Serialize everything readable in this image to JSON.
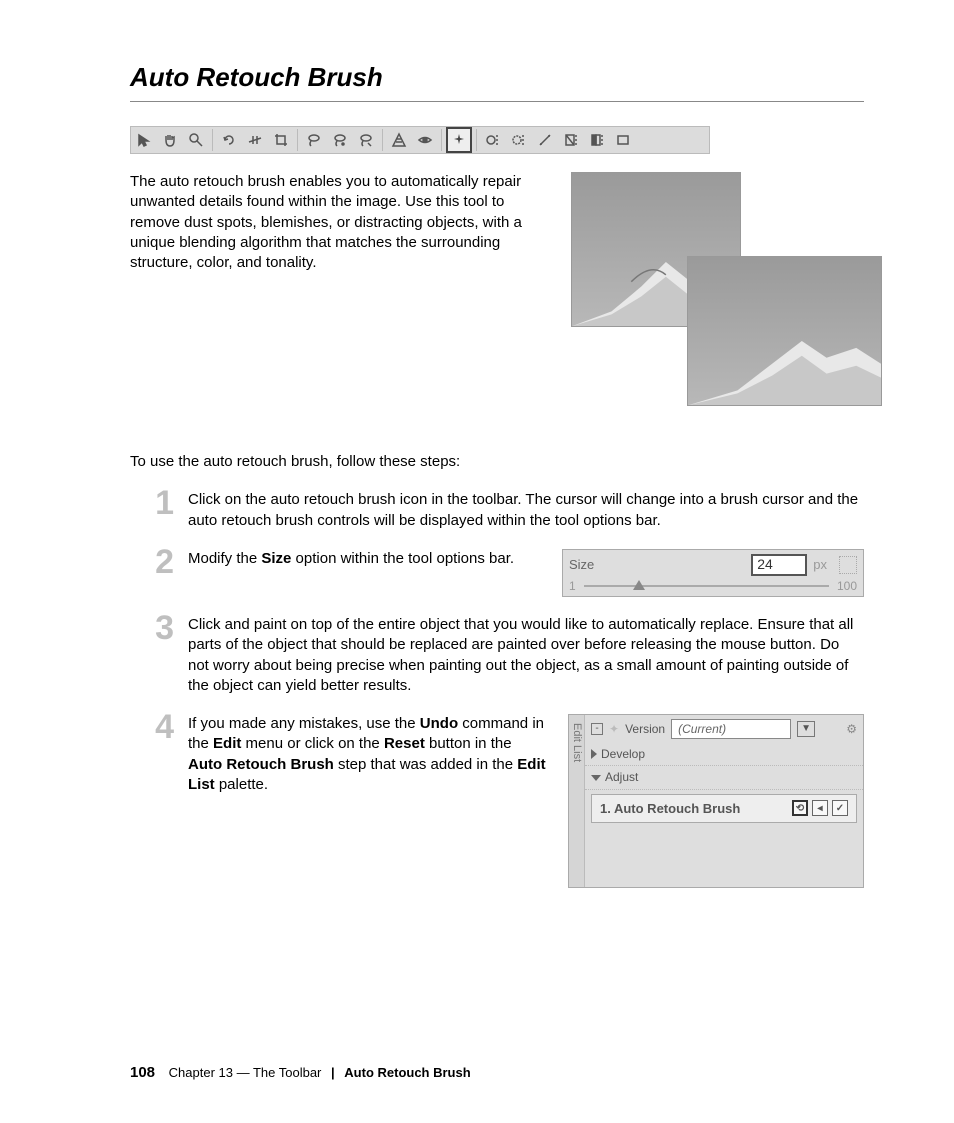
{
  "title": "Auto Retouch Brush",
  "intro": "The auto retouch brush enables you to automatically repair unwanted details found within the image. Use this tool to remove dust spots, blemishes, or distracting objects, with a unique blending algorithm that matches the surrounding structure, color, and tonality.",
  "followup": "To use the auto retouch brush, follow these steps:",
  "steps": {
    "s1": "Click on the auto retouch brush icon in the toolbar. The cursor will change into a brush cursor and the auto retouch brush controls will be displayed within the tool options bar.",
    "s2_pre": "Modify the ",
    "s2_bold": "Size",
    "s2_post": " option within the tool options bar.",
    "s3": "Click and paint on top of the entire object that you would like to automatically replace. Ensure that all parts of the object that should be replaced are painted over before releasing the mouse button. Do not worry about being precise when painting out the object, as a small amount of painting outside of the object can yield better results.",
    "s4_1": "If you made any mistakes, use the ",
    "s4_b1": "Undo",
    "s4_2": " command in the ",
    "s4_b2": "Edit",
    "s4_3": " menu or click on the ",
    "s4_b3": "Reset",
    "s4_4": " button in the ",
    "s4_b4": "Auto Retouch Brush",
    "s4_5": " step that was added in the ",
    "s4_b5": "Edit List",
    "s4_6": " palette."
  },
  "sizepanel": {
    "label": "Size",
    "value": "24",
    "unit": "px",
    "min": "1",
    "max": "100"
  },
  "editlist": {
    "tab": "Edit List",
    "version_label": "Version",
    "version_value": "(Current)",
    "develop": "Develop",
    "adjust": "Adjust",
    "step1": "1. Auto Retouch Brush"
  },
  "footer": {
    "page": "108",
    "chapter": "Chapter 13 — The Toolbar",
    "section": "Auto Retouch Brush"
  }
}
